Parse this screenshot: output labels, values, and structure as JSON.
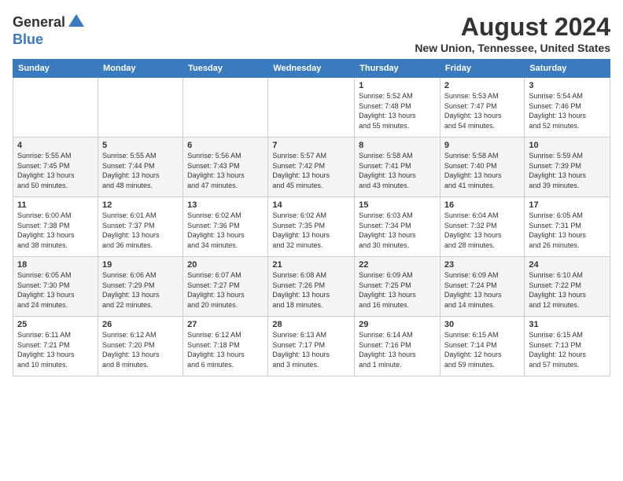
{
  "logo": {
    "general": "General",
    "blue": "Blue"
  },
  "title": "August 2024",
  "subtitle": "New Union, Tennessee, United States",
  "weekdays": [
    "Sunday",
    "Monday",
    "Tuesday",
    "Wednesday",
    "Thursday",
    "Friday",
    "Saturday"
  ],
  "weeks": [
    [
      {
        "day": "",
        "info": ""
      },
      {
        "day": "",
        "info": ""
      },
      {
        "day": "",
        "info": ""
      },
      {
        "day": "",
        "info": ""
      },
      {
        "day": "1",
        "info": "Sunrise: 5:52 AM\nSunset: 7:48 PM\nDaylight: 13 hours\nand 55 minutes."
      },
      {
        "day": "2",
        "info": "Sunrise: 5:53 AM\nSunset: 7:47 PM\nDaylight: 13 hours\nand 54 minutes."
      },
      {
        "day": "3",
        "info": "Sunrise: 5:54 AM\nSunset: 7:46 PM\nDaylight: 13 hours\nand 52 minutes."
      }
    ],
    [
      {
        "day": "4",
        "info": "Sunrise: 5:55 AM\nSunset: 7:45 PM\nDaylight: 13 hours\nand 50 minutes."
      },
      {
        "day": "5",
        "info": "Sunrise: 5:55 AM\nSunset: 7:44 PM\nDaylight: 13 hours\nand 48 minutes."
      },
      {
        "day": "6",
        "info": "Sunrise: 5:56 AM\nSunset: 7:43 PM\nDaylight: 13 hours\nand 47 minutes."
      },
      {
        "day": "7",
        "info": "Sunrise: 5:57 AM\nSunset: 7:42 PM\nDaylight: 13 hours\nand 45 minutes."
      },
      {
        "day": "8",
        "info": "Sunrise: 5:58 AM\nSunset: 7:41 PM\nDaylight: 13 hours\nand 43 minutes."
      },
      {
        "day": "9",
        "info": "Sunrise: 5:58 AM\nSunset: 7:40 PM\nDaylight: 13 hours\nand 41 minutes."
      },
      {
        "day": "10",
        "info": "Sunrise: 5:59 AM\nSunset: 7:39 PM\nDaylight: 13 hours\nand 39 minutes."
      }
    ],
    [
      {
        "day": "11",
        "info": "Sunrise: 6:00 AM\nSunset: 7:38 PM\nDaylight: 13 hours\nand 38 minutes."
      },
      {
        "day": "12",
        "info": "Sunrise: 6:01 AM\nSunset: 7:37 PM\nDaylight: 13 hours\nand 36 minutes."
      },
      {
        "day": "13",
        "info": "Sunrise: 6:02 AM\nSunset: 7:36 PM\nDaylight: 13 hours\nand 34 minutes."
      },
      {
        "day": "14",
        "info": "Sunrise: 6:02 AM\nSunset: 7:35 PM\nDaylight: 13 hours\nand 32 minutes."
      },
      {
        "day": "15",
        "info": "Sunrise: 6:03 AM\nSunset: 7:34 PM\nDaylight: 13 hours\nand 30 minutes."
      },
      {
        "day": "16",
        "info": "Sunrise: 6:04 AM\nSunset: 7:32 PM\nDaylight: 13 hours\nand 28 minutes."
      },
      {
        "day": "17",
        "info": "Sunrise: 6:05 AM\nSunset: 7:31 PM\nDaylight: 13 hours\nand 26 minutes."
      }
    ],
    [
      {
        "day": "18",
        "info": "Sunrise: 6:05 AM\nSunset: 7:30 PM\nDaylight: 13 hours\nand 24 minutes."
      },
      {
        "day": "19",
        "info": "Sunrise: 6:06 AM\nSunset: 7:29 PM\nDaylight: 13 hours\nand 22 minutes."
      },
      {
        "day": "20",
        "info": "Sunrise: 6:07 AM\nSunset: 7:27 PM\nDaylight: 13 hours\nand 20 minutes."
      },
      {
        "day": "21",
        "info": "Sunrise: 6:08 AM\nSunset: 7:26 PM\nDaylight: 13 hours\nand 18 minutes."
      },
      {
        "day": "22",
        "info": "Sunrise: 6:09 AM\nSunset: 7:25 PM\nDaylight: 13 hours\nand 16 minutes."
      },
      {
        "day": "23",
        "info": "Sunrise: 6:09 AM\nSunset: 7:24 PM\nDaylight: 13 hours\nand 14 minutes."
      },
      {
        "day": "24",
        "info": "Sunrise: 6:10 AM\nSunset: 7:22 PM\nDaylight: 13 hours\nand 12 minutes."
      }
    ],
    [
      {
        "day": "25",
        "info": "Sunrise: 6:11 AM\nSunset: 7:21 PM\nDaylight: 13 hours\nand 10 minutes."
      },
      {
        "day": "26",
        "info": "Sunrise: 6:12 AM\nSunset: 7:20 PM\nDaylight: 13 hours\nand 8 minutes."
      },
      {
        "day": "27",
        "info": "Sunrise: 6:12 AM\nSunset: 7:18 PM\nDaylight: 13 hours\nand 6 minutes."
      },
      {
        "day": "28",
        "info": "Sunrise: 6:13 AM\nSunset: 7:17 PM\nDaylight: 13 hours\nand 3 minutes."
      },
      {
        "day": "29",
        "info": "Sunrise: 6:14 AM\nSunset: 7:16 PM\nDaylight: 13 hours\nand 1 minute."
      },
      {
        "day": "30",
        "info": "Sunrise: 6:15 AM\nSunset: 7:14 PM\nDaylight: 12 hours\nand 59 minutes."
      },
      {
        "day": "31",
        "info": "Sunrise: 6:15 AM\nSunset: 7:13 PM\nDaylight: 12 hours\nand 57 minutes."
      }
    ]
  ]
}
